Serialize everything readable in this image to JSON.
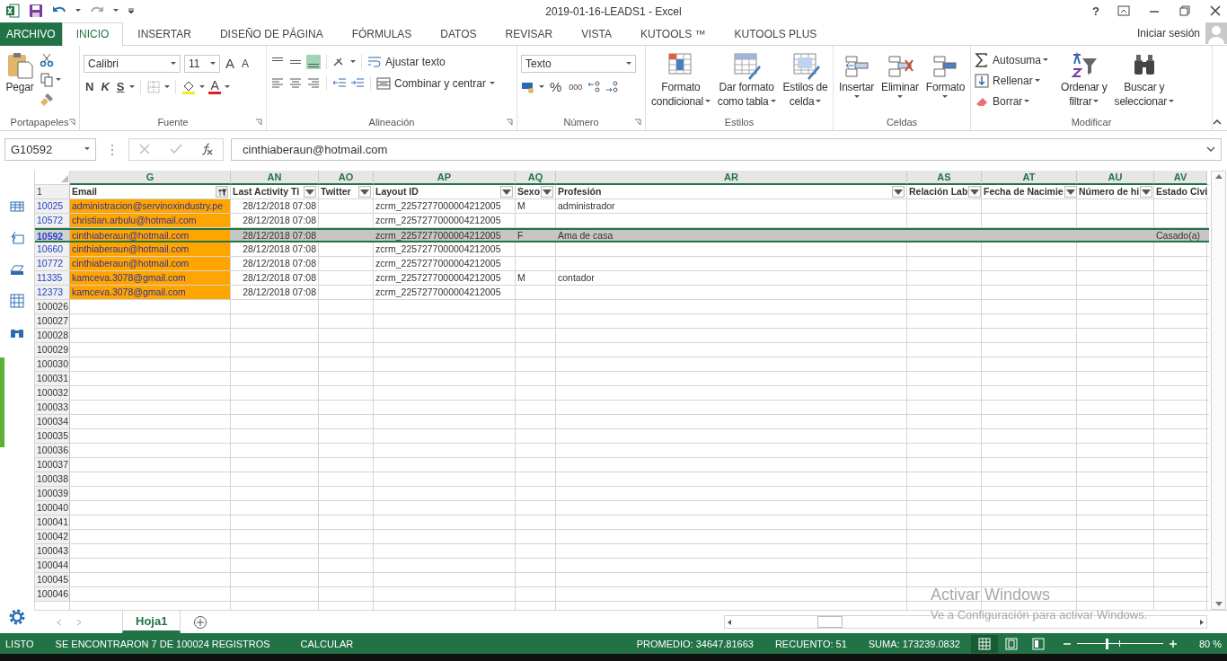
{
  "window": {
    "title": "2019-01-16-LEADS1 - Excel",
    "help": "?"
  },
  "tabs": [
    {
      "label": "ARCHIVO",
      "kind": "file",
      "selected": false
    },
    {
      "label": "INICIO",
      "kind": "tab",
      "selected": true
    },
    {
      "label": "INSERTAR",
      "kind": "tab",
      "selected": false
    },
    {
      "label": "DISEÑO DE PÁGINA",
      "kind": "tab",
      "selected": false
    },
    {
      "label": "FÓRMULAS",
      "kind": "tab",
      "selected": false
    },
    {
      "label": "DATOS",
      "kind": "tab",
      "selected": false
    },
    {
      "label": "REVISAR",
      "kind": "tab",
      "selected": false
    },
    {
      "label": "VISTA",
      "kind": "tab",
      "selected": false
    },
    {
      "label": "KUTOOLS ™",
      "kind": "tab",
      "selected": false
    },
    {
      "label": "KUTOOLS PLUS",
      "kind": "tab",
      "selected": false
    }
  ],
  "account": {
    "label": "Iniciar sesión"
  },
  "ribbon": {
    "clipboard": {
      "label": "Portapapeles",
      "paste": "Pegar"
    },
    "font": {
      "label": "Fuente",
      "family": "Calibri",
      "size": "11",
      "grow": "A",
      "shrink": "A",
      "bold": "N",
      "italic": "K",
      "underline": "S",
      "color_button": "A"
    },
    "alignment": {
      "label": "Alineación",
      "vertical": [
        {
          "selected": false
        },
        {
          "selected": false
        },
        {
          "selected": true
        }
      ],
      "wrap": "Ajustar texto",
      "merge": "Combinar y centrar"
    },
    "number": {
      "label": "Número",
      "format": "Texto",
      "percent": "%",
      "thousands": "000"
    },
    "styles": {
      "label": "Estilos",
      "buttons": [
        [
          "Formato",
          "condicional"
        ],
        [
          "Dar formato",
          "como tabla"
        ],
        [
          "Estilos de",
          "celda"
        ]
      ]
    },
    "cells": {
      "label": "Celdas",
      "buttons": [
        "Insertar",
        "Eliminar",
        "Formato"
      ]
    },
    "editing": {
      "label": "Modificar",
      "autosum": "Autosuma",
      "fill": "Rellenar",
      "clear": "Borrar",
      "sort": [
        "Ordenar y",
        "filtrar"
      ],
      "find": [
        "Buscar y",
        "seleccionar"
      ]
    }
  },
  "formula_bar": {
    "name_box": "G10592",
    "value": "cinthiaberaun@hotmail.com"
  },
  "sheet": {
    "columns": [
      {
        "letter": "G",
        "field": "Email",
        "filtered": true
      },
      {
        "letter": "AN",
        "field": "Last Activity Ti",
        "filtered": false
      },
      {
        "letter": "AO",
        "field": "Twitter",
        "filtered": false
      },
      {
        "letter": "AP",
        "field": "Layout ID",
        "filtered": false
      },
      {
        "letter": "AQ",
        "field": "Sexo",
        "filtered": false
      },
      {
        "letter": "AR",
        "field": "Profesión",
        "filtered": false
      },
      {
        "letter": "AS",
        "field": "Relación Lab",
        "filtered": false
      },
      {
        "letter": "AT",
        "field": "Fecha de Nacimie",
        "filtered": false
      },
      {
        "letter": "AU",
        "field": "Número de hi",
        "filtered": false
      },
      {
        "letter": "AV",
        "field": "Estado Civi"
      }
    ],
    "header_row": "1",
    "rows": [
      {
        "number": "10025",
        "selected": false,
        "highlighted": true,
        "cells": [
          "administracion@servinoxindustry.pe",
          "28/12/2018 07:08",
          "",
          "zcrm_2257277000004212005",
          "M",
          "administrador",
          "",
          "",
          "",
          ""
        ]
      },
      {
        "number": "10572",
        "selected": false,
        "highlighted": true,
        "cells": [
          "christian.arbulu@hotmail.com",
          "28/12/2018 07:08",
          "",
          "zcrm_2257277000004212005",
          "",
          "",
          "",
          "",
          "",
          ""
        ]
      },
      {
        "number": "10592",
        "selected": true,
        "highlighted": true,
        "cells": [
          "cinthiaberaun@hotmail.com",
          "28/12/2018 07:08",
          "",
          "zcrm_2257277000004212005",
          "F",
          "Ama de casa",
          "",
          "",
          "",
          "Casado(a)"
        ]
      },
      {
        "number": "10660",
        "selected": false,
        "highlighted": true,
        "cells": [
          "cinthiaberaun@hotmail.com",
          "28/12/2018 07:08",
          "",
          "zcrm_2257277000004212005",
          "",
          "",
          "",
          "",
          "",
          ""
        ]
      },
      {
        "number": "10772",
        "selected": false,
        "highlighted": true,
        "cells": [
          "cinthiaberaun@hotmail.com",
          "28/12/2018 07:08",
          "",
          "zcrm_2257277000004212005",
          "",
          "",
          "",
          "",
          "",
          ""
        ]
      },
      {
        "number": "11335",
        "selected": false,
        "highlighted": true,
        "cells": [
          "kamceva.3078@gmail.com",
          "28/12/2018 07:08",
          "",
          "zcrm_2257277000004212005",
          "M",
          "contador",
          "",
          "",
          "",
          ""
        ]
      },
      {
        "number": "12373",
        "selected": false,
        "highlighted": true,
        "cells": [
          "kamceva.3078@gmail.com",
          "28/12/2018 07:08",
          "",
          "zcrm_2257277000004212005",
          "",
          "",
          "",
          "",
          "",
          ""
        ]
      }
    ],
    "empty_rows": [
      "100026",
      "100027",
      "100028",
      "100029",
      "100030",
      "100031",
      "100032",
      "100033",
      "100034",
      "100035",
      "100036",
      "100037",
      "100038",
      "100039",
      "100040",
      "100041",
      "100042",
      "100043",
      "100044",
      "100045",
      "100046"
    ]
  },
  "sheet_tabs": [
    {
      "label": "Hoja1",
      "selected": true
    }
  ],
  "status_bar": {
    "mode": "LISTO",
    "filter_info": "SE ENCONTRARON 7 DE 100024 REGISTROS",
    "calculate": "CALCULAR",
    "average": "PROMEDIO: 34647.81663",
    "count": "RECUENTO: 51",
    "sum": "SUMA: 173239.0832",
    "zoom": "80 %",
    "zoom_level": {
      "level": 0.34
    }
  },
  "watermark": {
    "title": "Activar Windows",
    "subtitle": "Ve a Configuración para activar Windows."
  }
}
